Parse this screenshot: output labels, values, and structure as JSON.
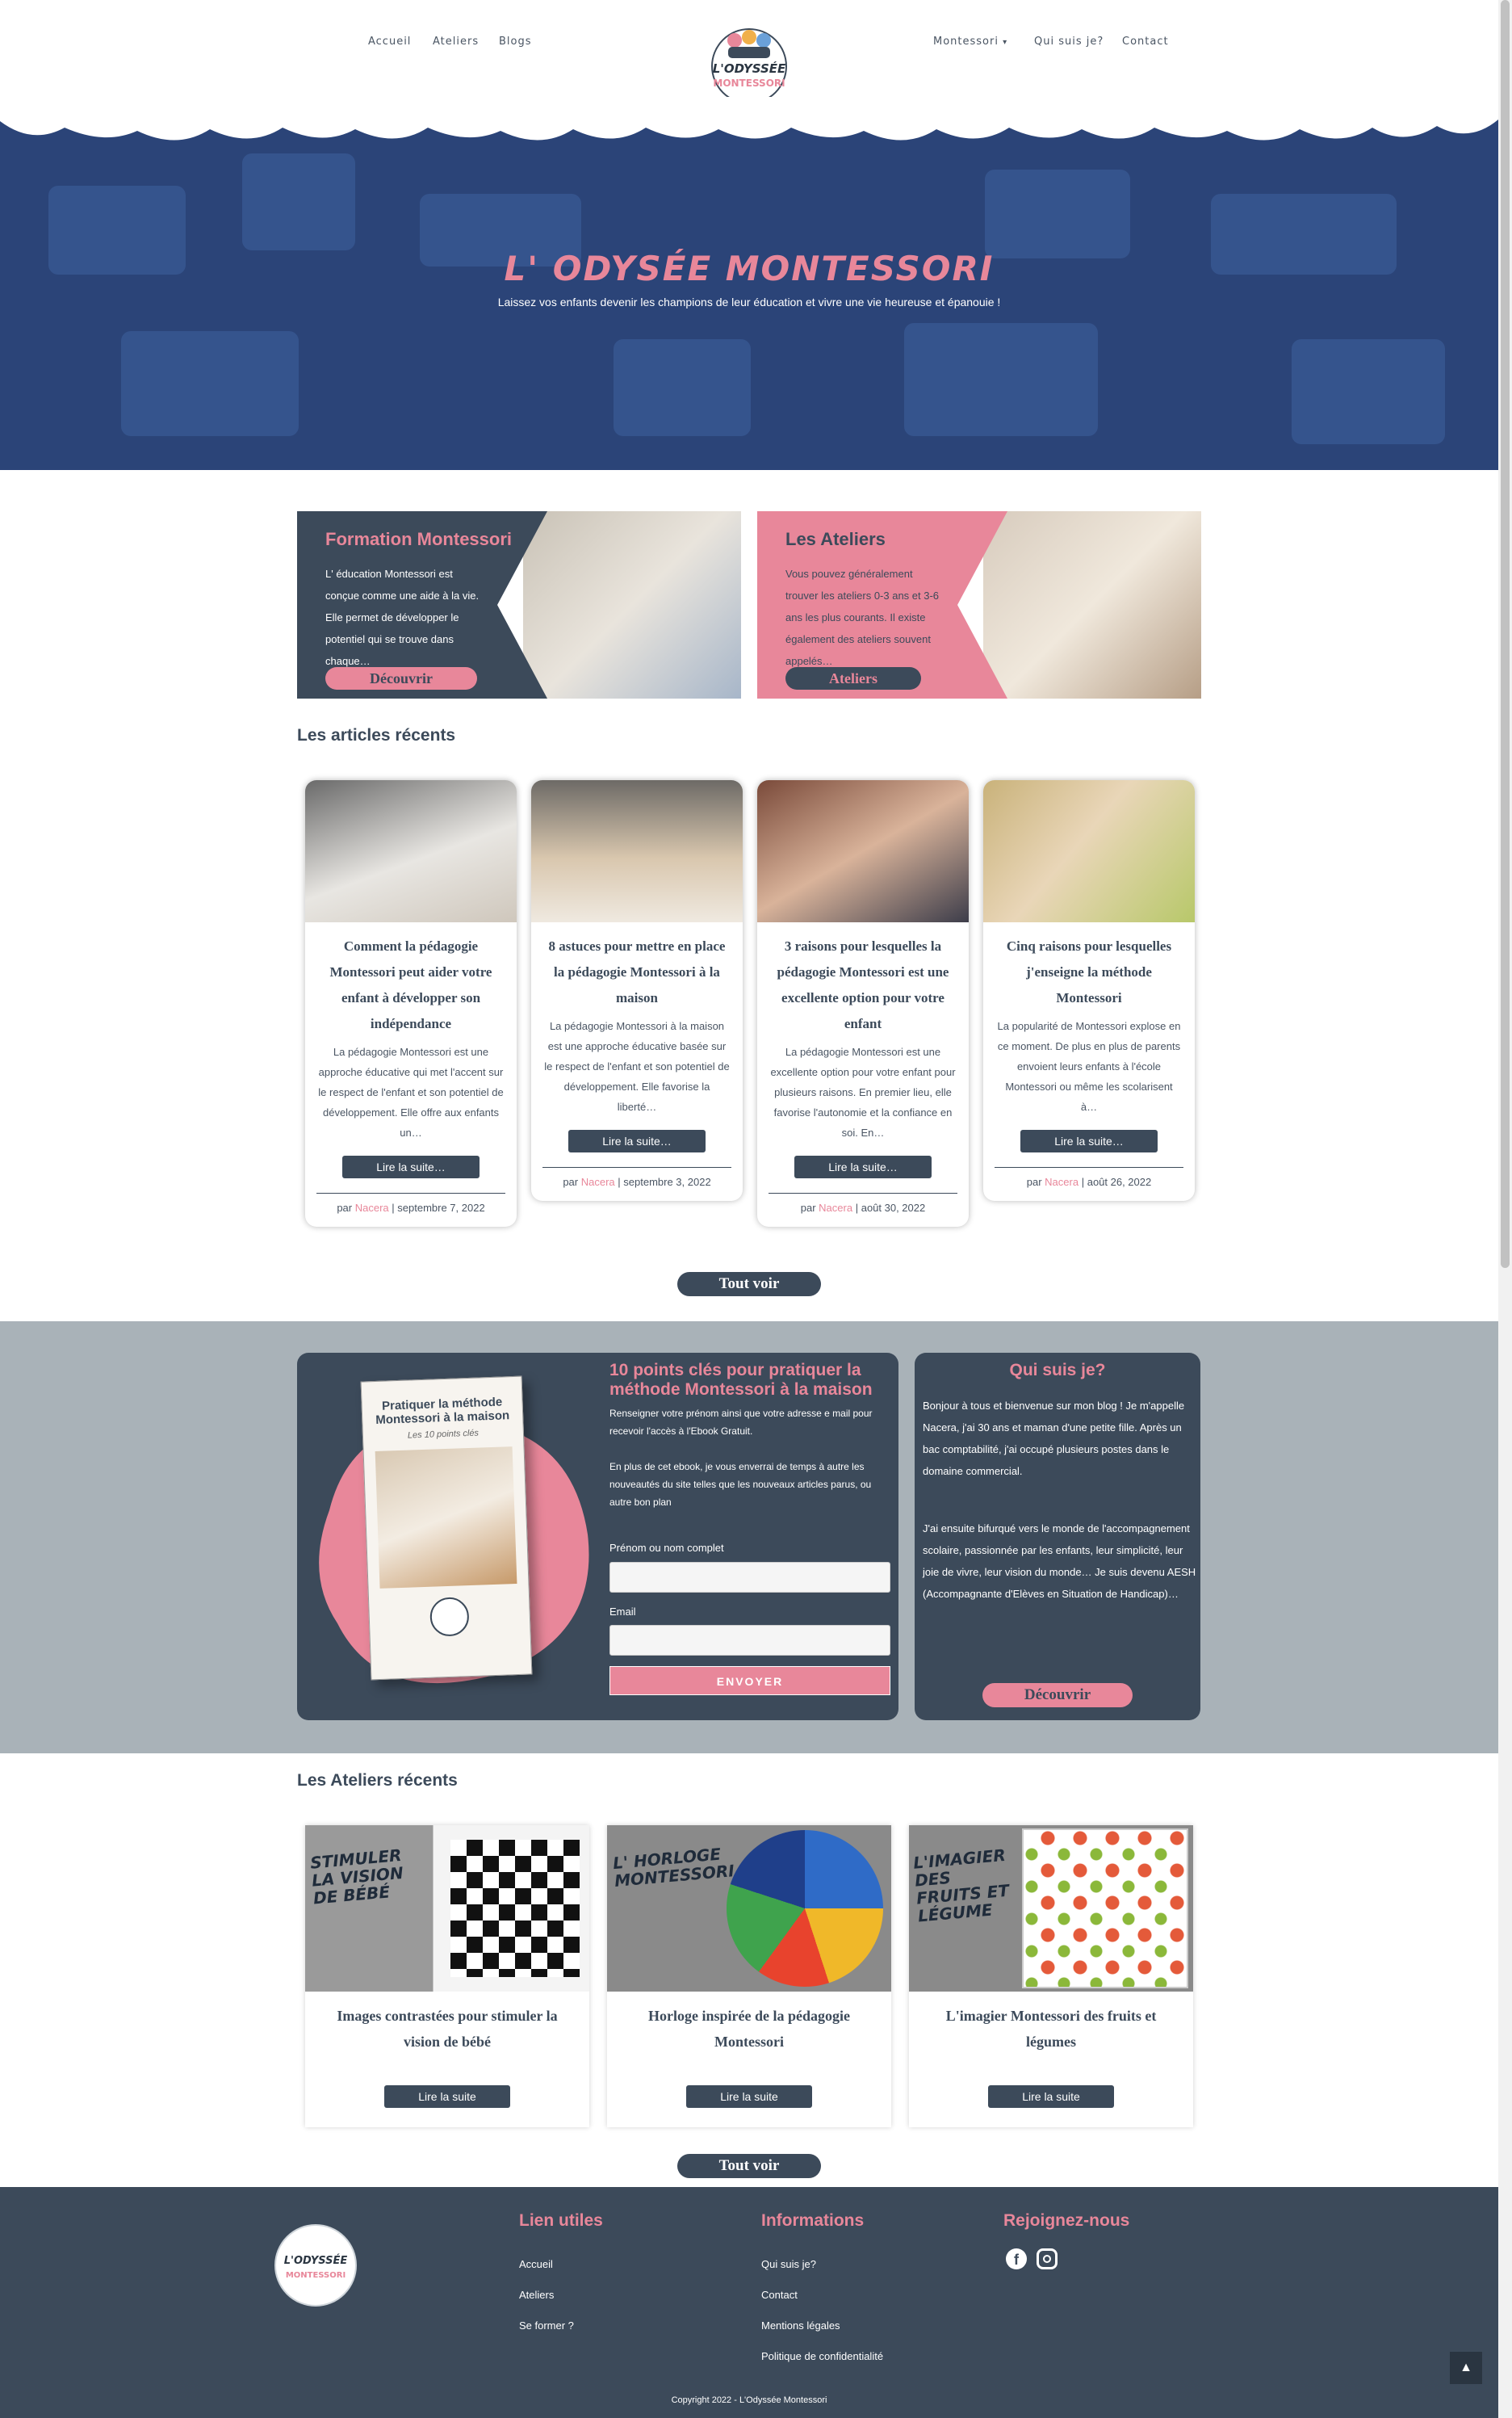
{
  "nav": {
    "left": [
      "Accueil",
      "Ateliers",
      "Blogs"
    ],
    "right": [
      "Montessori",
      "Qui suis je?",
      "Contact"
    ],
    "logo_text": [
      "L'ODYSSÉE",
      "MONTESSORI"
    ]
  },
  "hero": {
    "title": "L' ODYSÉE MONTESSORI",
    "subtitle": "Laissez vos enfants devenir les champions de leur éducation et vivre une vie heureuse et épanouie !"
  },
  "promos": [
    {
      "title": "Formation Montessori",
      "text": "L' éducation Montessori est conçue comme une aide à la vie. Elle permet de développer le potentiel qui se trouve dans chaque…",
      "button": "Découvrir"
    },
    {
      "title": "Les Ateliers",
      "text": "Vous pouvez généralement trouver les ateliers 0-3 ans et 3-6 ans les plus courants. Il existe également des ateliers souvent appelés…",
      "button": "Ateliers"
    }
  ],
  "recent_articles": {
    "title": "Les articles récents",
    "items": [
      {
        "title": "Comment la pédagogie Montessori peut aider votre enfant à développer son indépendance",
        "excerpt": "La pédagogie Montessori est une approche éducative qui met l'accent sur le respect de l'enfant et son potentiel de développement. Elle offre aux enfants un…",
        "read": "Lire la suite…",
        "by": "par",
        "author": "Nacera",
        "date": "| septembre 7, 2022"
      },
      {
        "title": "8 astuces pour mettre en place la pédagogie Montessori à la maison",
        "excerpt": "La pédagogie Montessori à la maison est une approche éducative basée sur le respect de l'enfant et son potentiel de développement. Elle favorise la liberté…",
        "read": "Lire la suite…",
        "by": "par",
        "author": "Nacera",
        "date": "| septembre 3, 2022"
      },
      {
        "title": "3 raisons pour lesquelles la pédagogie Montessori est une excellente option pour votre enfant",
        "excerpt": "La pédagogie Montessori est une excellente option pour votre enfant pour plusieurs raisons. En premier lieu, elle favorise l'autonomie et la confiance en soi. En…",
        "read": "Lire la suite…",
        "by": "par",
        "author": "Nacera",
        "date": "| août 30, 2022"
      },
      {
        "title": "Cinq raisons pour lesquelles j'enseigne la méthode Montessori",
        "excerpt": "La popularité de Montessori explose en ce moment. De plus en plus de parents envoient leurs enfants à l'école Montessori ou même les scolarisent à…",
        "read": "Lire la suite…",
        "by": "par",
        "author": "Nacera",
        "date": "| août 26, 2022"
      }
    ],
    "see_all": "Tout voir"
  },
  "newsletter": {
    "title": "10 points clés pour pratiquer la méthode Montessori à la maison",
    "desc1": "Renseigner votre prénom ainsi que votre adresse e mail pour recevoir l'accès à l'Ebook Gratuit.",
    "desc2": "En plus de cet ebook, je vous enverrai de temps à autre les nouveautés du site telles que les nouveaux articles parus, ou autre bon plan",
    "name_label": "Prénom ou nom complet",
    "email_label": "Email",
    "submit": "ENVOYER",
    "book_title": "Pratiquer la méthode Montessori à la maison",
    "book_sub": "Les 10 points clés"
  },
  "about": {
    "title": "Qui suis je?",
    "p1": "Bonjour à tous et bienvenue sur mon blog ! Je m'appelle Nacera, j'ai 30 ans et maman d'une petite fille. Après un bac comptabilité, j'ai occupé plusieurs postes dans le domaine commercial.",
    "p2": "J'ai ensuite bifurqué vers le monde de l'accompagnement scolaire, passionnée par les enfants, leur simplicité, leur joie de vivre, leur vision du monde… Je suis devenu AESH (Accompagnante d'Elèves en Situation de Handicap)…",
    "button": "Découvrir"
  },
  "recent_workshops": {
    "title": "Les Ateliers récents",
    "items": [
      {
        "overlay": "STIMULER LA VISION DE BÉBÉ",
        "title": "Images contrastées pour stimuler la vision de bébé",
        "read": "Lire la suite"
      },
      {
        "overlay": "L' HORLOGE MONTESSORI",
        "title": "Horloge inspirée de la pédagogie Montessori",
        "read": "Lire la suite"
      },
      {
        "overlay": "L'IMAGIER DES FRUITS ET LÉGUME",
        "title": "L'imagier Montessori des fruits et légumes",
        "read": "Lire la suite"
      }
    ],
    "see_all": "Tout voir"
  },
  "footer": {
    "links_title": "Lien utiles",
    "links": [
      "Accueil",
      "Ateliers",
      "Se former ?"
    ],
    "info_title": "Informations",
    "info": [
      "Qui suis je?",
      "Contact",
      "Mentions légales",
      "Politique de confidentialité"
    ],
    "join_title": "Rejoignez-nous",
    "copyright": "Copyright 2022 - L'Odyssée Montessori"
  },
  "colors": {
    "accent": "#e8879a",
    "dark": "#3c4a5a",
    "hero": "#2b4478"
  },
  "icons": [
    "facebook-icon",
    "instagram-icon",
    "arrow-up-icon",
    "chevron-down-icon"
  ]
}
